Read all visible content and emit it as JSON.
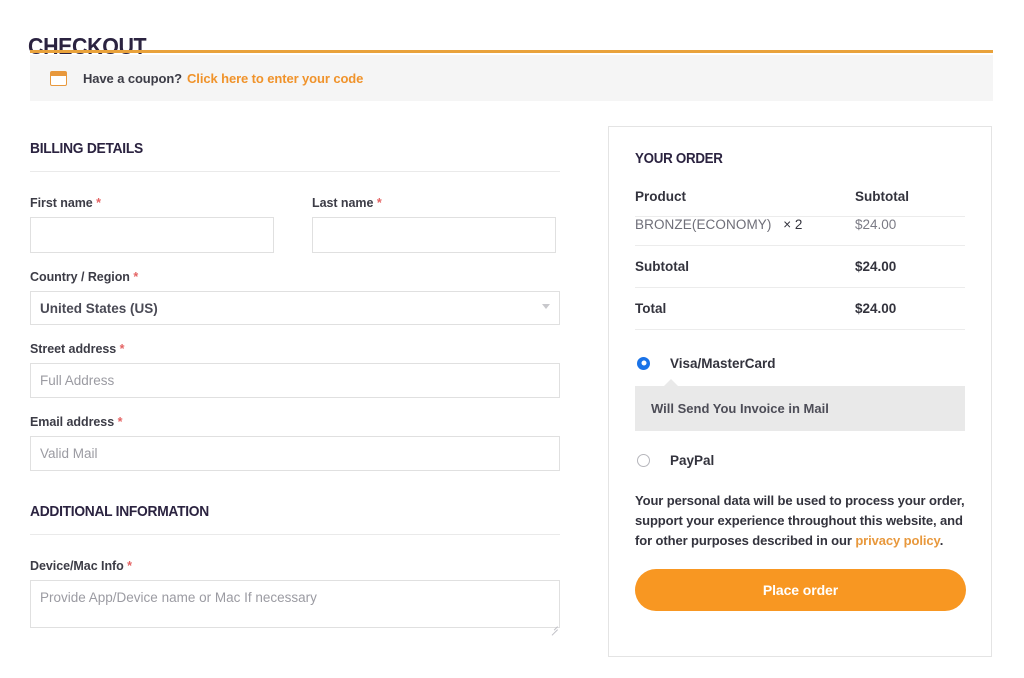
{
  "page": {
    "title": "CHECKOUT"
  },
  "coupon": {
    "icon": "coupon-ticket-icon",
    "prompt": "Have a coupon?",
    "link_label": "Click here to enter your code"
  },
  "billing": {
    "heading": "BILLING DETAILS",
    "fields": {
      "first_name": {
        "label": "First name",
        "required": "*",
        "value": "",
        "placeholder": ""
      },
      "last_name": {
        "label": "Last name",
        "required": "*",
        "value": "",
        "placeholder": ""
      },
      "country": {
        "label": "Country / Region",
        "required": "*",
        "value": "United States (US)"
      },
      "street": {
        "label": "Street address",
        "required": "*",
        "value": "",
        "placeholder": "Full Address"
      },
      "email": {
        "label": "Email address",
        "required": "*",
        "value": "",
        "placeholder": "Valid Mail"
      }
    }
  },
  "additional": {
    "heading": "ADDITIONAL INFORMATION",
    "device": {
      "label": "Device/Mac Info",
      "required": "*",
      "value": "",
      "placeholder": "Provide App/Device name or Mac If necessary"
    }
  },
  "order": {
    "heading": "YOUR ORDER",
    "columns": {
      "product": "Product",
      "subtotal": "Subtotal"
    },
    "items": [
      {
        "name": "BRONZE(ECONOMY)",
        "qty": "× 2",
        "price": "$24.00"
      }
    ],
    "totals": [
      {
        "label": "Subtotal",
        "amount": "$24.00"
      },
      {
        "label": "Total",
        "amount": "$24.00"
      }
    ],
    "payment_methods": [
      {
        "id": "visa_mastercard",
        "label": "Visa/MasterCard",
        "selected": true,
        "note": "Will Send You Invoice in Mail"
      },
      {
        "id": "paypal",
        "label": "PayPal",
        "selected": false
      }
    ],
    "privacy_text_before": "Your personal data will be used to process your order, support your experience throughout this website, and for other purposes described in our ",
    "privacy_link": "privacy policy",
    "privacy_text_after": ".",
    "place_order_label": "Place order"
  },
  "colors": {
    "accent_orange": "#f89722",
    "rule_orange": "#e9a23b",
    "heading_navy": "#2b2340",
    "required_red": "#e46363",
    "radio_blue": "#1a73e8",
    "coupon_bg": "#f5f5f5",
    "note_bg": "#e9e9e9"
  }
}
